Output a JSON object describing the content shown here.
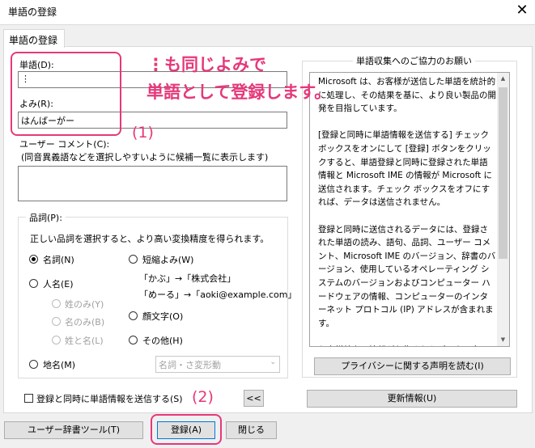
{
  "window": {
    "title": "単語の登録",
    "close_label": "✕"
  },
  "tab": {
    "label": "単語の登録"
  },
  "word": {
    "label": "単語(D):",
    "value": "⋮"
  },
  "reading": {
    "label": "よみ(R):",
    "value": "はんばーがー"
  },
  "comment": {
    "label": "ユーザー コメント(C):",
    "hint": "(同音異義語などを選択しやすいように候補一覧に表示します)",
    "value": ""
  },
  "pos": {
    "legend": "品詞(P):",
    "desc": "正しい品詞を選択すると、より高い変換精度を得られます。",
    "noun": "名詞(N)",
    "person": "人名(E)",
    "surname": "姓のみ(Y)",
    "givenname": "名のみ(B)",
    "fullname": "姓と名(L)",
    "place": "地名(M)",
    "short": "短縮よみ(W)",
    "example1": "「かぶ」→「株式会社」",
    "example2": "「めーる」→「aoki@example.com」",
    "emoticon": "顔文字(O)",
    "other": "その他(H)",
    "select_value": "名詞・さ変形動"
  },
  "send": {
    "label": "登録と同時に単語情報を送信する(S)",
    "collapse_label": "<<"
  },
  "info": {
    "legend": "単語収集へのご協力のお願い",
    "text": "Microsoft は、お客様が送信した単語を統計的に処理し、その結果を基に、より良い製品の開発を目指しています。\n\n[登録と同時に単語情報を送信する] チェック ボックスをオンにして [登録] ボタンをクリックすると、単語登録と同時に登録された単語情報と Microsoft IME の情報が Microsoft に送信されます。チェック ボックスをオフにすれば、データは送信されません。\n\n登録と同時に送信されるデータには、登録された単語の読み、語句、品詞、ユーザー コメント、Microsoft IME のバージョン、辞書のバージョン、使用しているオペレーティング システムのバージョンおよびコンピューター ハードウェアの情報、コンピューターのインターネット プロトコル (IP) アドレスが含まれます。\n\nお客様特有の情報が収集されたデータに含まれることがあります。このような情報が存在する場合でも、Microsoft では、お客様を特定するために使用することはありません。",
    "privacy_button": "プライバシーに関する声明を読む(I)",
    "update_button": "更新情報(U)"
  },
  "footer": {
    "user_dict_button": "ユーザー辞書ツール(T)",
    "register_button": "登録(A)",
    "close_button": "閉じる"
  },
  "annotations": {
    "note_line1": "⋮も同じよみで",
    "note_line2": "単語として登録します。",
    "step1": "(1)",
    "step2": "(2)"
  },
  "colors": {
    "highlight": "#e6387a",
    "window_bg": "#f0f0f0"
  }
}
